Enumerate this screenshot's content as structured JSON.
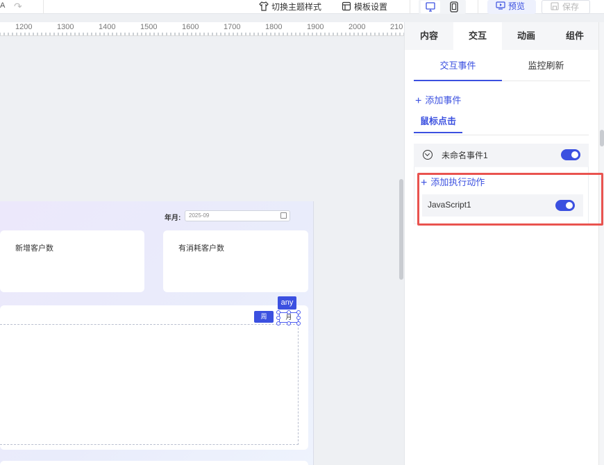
{
  "toolbar": {
    "theme_label": "切换主题样式",
    "template_label": "模板设置",
    "preview_label": "预览",
    "save_label": "保存",
    "left_fragment": "A"
  },
  "ruler": {
    "ticks": [
      "1200",
      "1300",
      "1400",
      "1500",
      "1600",
      "1700",
      "1800",
      "1900",
      "2000",
      "210"
    ]
  },
  "canvas": {
    "year_month_label": "年月:",
    "year_month_value": "2025-09",
    "card_new_customers": "新增客户数",
    "card_consuming_customers": "有消耗客户数",
    "btn_week": "周",
    "btn_month": "月",
    "selection_tag": "any"
  },
  "panel": {
    "tabs": [
      {
        "label": "内容"
      },
      {
        "label": "交互"
      },
      {
        "label": "动画"
      },
      {
        "label": "组件"
      }
    ],
    "active_tab": "交互",
    "sub_tabs": [
      {
        "label": "交互事件"
      },
      {
        "label": "监控刷新"
      }
    ],
    "add_event_label": "添加事件",
    "mouse_click_tab": "鼠标点击",
    "event": {
      "name": "未命名事件1",
      "enabled": true,
      "add_action_label": "添加执行动作",
      "actions": [
        {
          "name": "JavaScript1",
          "enabled": true
        }
      ]
    }
  },
  "colors": {
    "accent": "#3b50e0",
    "highlight": "#e9534f"
  }
}
